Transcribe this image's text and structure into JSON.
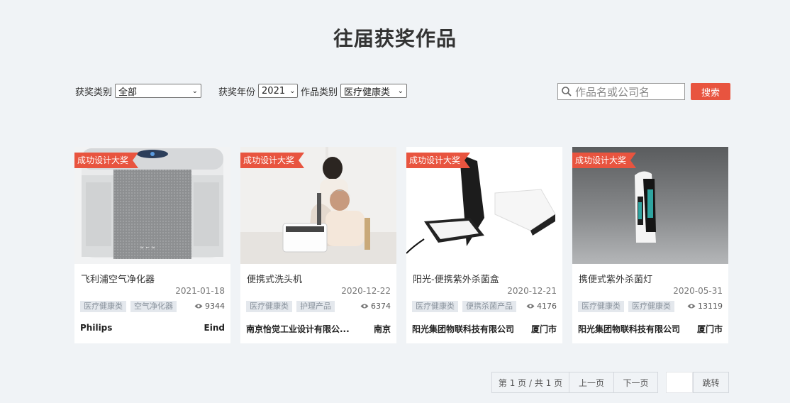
{
  "header": {
    "title": "往届获奖作品"
  },
  "filters": {
    "award_type_label": "获奖类别",
    "award_type_value": "全部",
    "award_year_label": "获奖年份",
    "award_year_value": "2021",
    "work_category_label": "作品类别",
    "work_category_value": "医疗健康类"
  },
  "search": {
    "placeholder": "作品名或公司名",
    "button_label": "搜索"
  },
  "cards": [
    {
      "ribbon": "成功设计大奖",
      "title": "飞利浦空气净化器",
      "date": "2021-01-18",
      "tags": [
        "医疗健康类",
        "空气净化器"
      ],
      "views": "9344",
      "company": "Philips",
      "city": "Eind"
    },
    {
      "ribbon": "成功设计大奖",
      "title": "便携式洗头机",
      "date": "2020-12-22",
      "tags": [
        "医疗健康类",
        "护理产品"
      ],
      "views": "6374",
      "company": "南京怡觉工业设计有限公...",
      "city": "南京"
    },
    {
      "ribbon": "成功设计大奖",
      "title": "阳光-便携紫外杀菌盒",
      "date": "2020-12-21",
      "tags": [
        "医疗健康类",
        "便携杀菌产品"
      ],
      "views": "4176",
      "company": "阳光集团物联科技有限公司",
      "city": "厦门市"
    },
    {
      "ribbon": "成功设计大奖",
      "title": "携便式紫外杀菌灯",
      "date": "2020-05-31",
      "tags": [
        "医疗健康类",
        "医疗健康类"
      ],
      "views": "13119",
      "company": "阳光集团物联科技有限公司",
      "city": "厦门市"
    }
  ],
  "pagination": {
    "page_info": "第 1 页 / 共 1 页",
    "prev_label": "上一页",
    "next_label": "下一页",
    "jump_label": "跳转"
  },
  "colors": {
    "accent": "#e8543f",
    "background": "#f0f3f6",
    "tag_bg": "#e4e8ed"
  }
}
